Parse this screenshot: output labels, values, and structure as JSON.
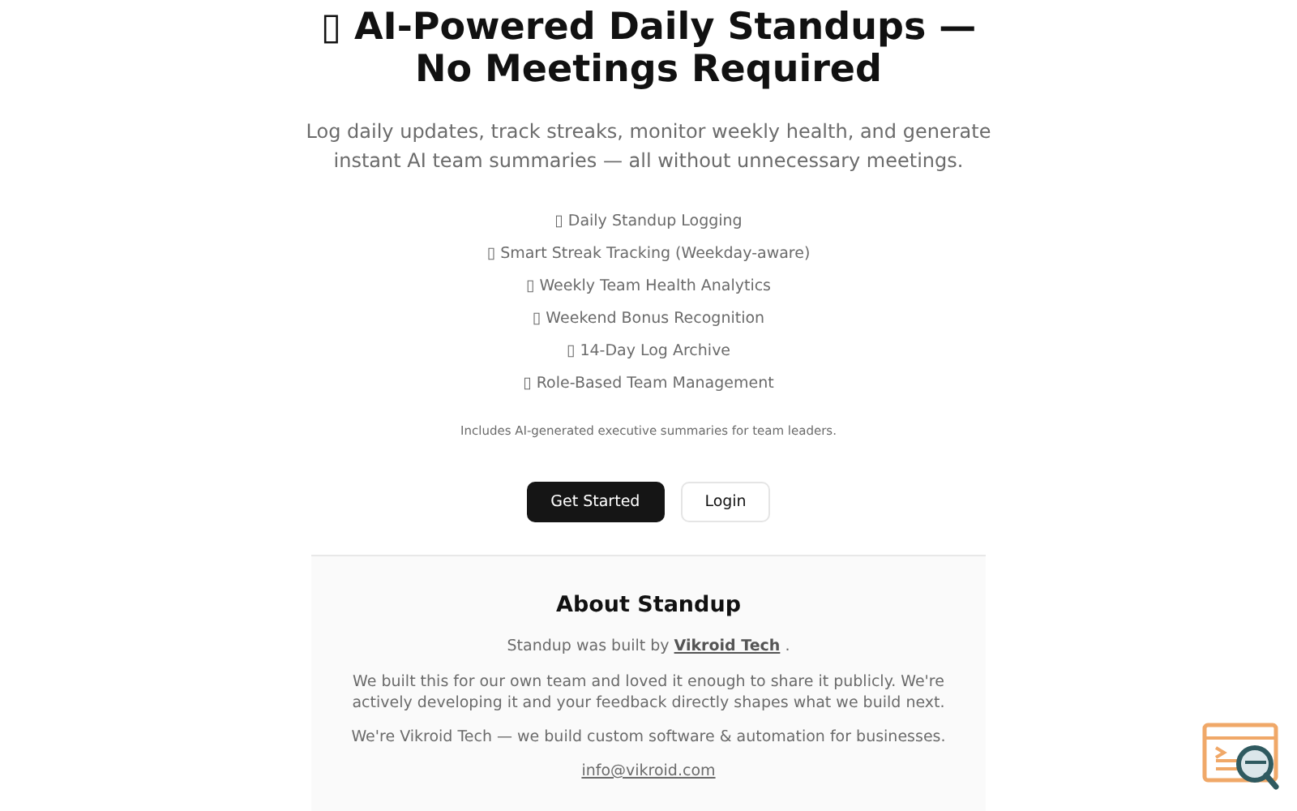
{
  "hero": {
    "title_line_1": "▯ AI-Powered Daily Standups —",
    "title_line_2": "No Meetings Required",
    "subtitle": "Log daily updates, track streaks, monitor weekly health, and generate instant AI team summaries — all without unnecessary meetings."
  },
  "features": [
    "▯ Daily Standup Logging",
    "▯ Smart Streak Tracking (Weekday-aware)",
    "▯ Weekly Team Health Analytics",
    "▯ Weekend Bonus Recognition",
    "▯ 14-Day Log Archive",
    "▯ Role-Based Team Management"
  ],
  "note": "Includes AI-generated executive summaries for team leaders.",
  "buttons": [
    {
      "label": "Get Started",
      "kind": "primary"
    },
    {
      "label": "Login",
      "kind": "secondary"
    }
  ],
  "about": {
    "title": "About Standup",
    "credit_before": "Standup was built by ",
    "credit_link": "Vikroid Tech",
    "credit_after": ".",
    "paragraphs": [
      "We built this for our own team and loved it enough to share it publicly. We're actively developing it and your feedback directly shapes what we build next.",
      "We're Vikroid Tech — we build custom software & automation for businesses."
    ],
    "email": "info@vikroid.com"
  }
}
